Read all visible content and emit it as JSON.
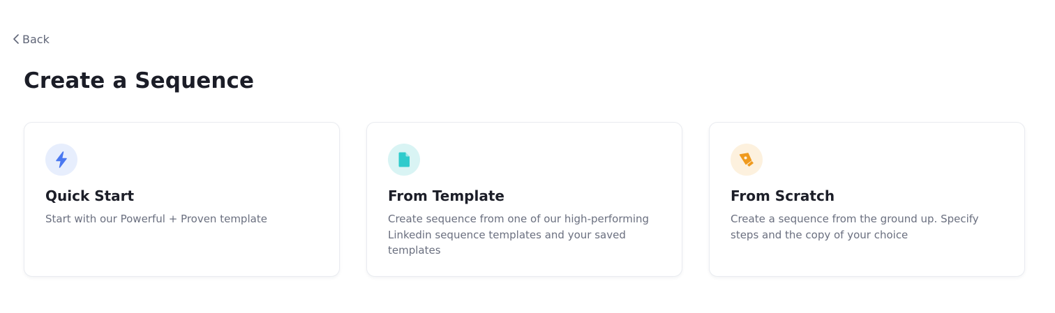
{
  "back": {
    "label": "Back"
  },
  "page": {
    "title": "Create a Sequence"
  },
  "cards": [
    {
      "icon": "lightning-bolt-icon",
      "icon_color": "#4a78f0",
      "icon_bg": "#e7eefd",
      "title": "Quick Start",
      "description": "Start with our Powerful + Proven template"
    },
    {
      "icon": "document-icon",
      "icon_color": "#2fcbcc",
      "icon_bg": "#d9f4f4",
      "title": "From Template",
      "description": "Create sequence from one of our high-performing Linkedin sequence templates and your saved templates"
    },
    {
      "icon": "pen-tool-icon",
      "icon_color": "#ef9a1e",
      "icon_bg": "#fdf1de",
      "title": "From Scratch",
      "description": "Create a sequence from the ground up. Specify steps and the copy of your choice"
    }
  ]
}
